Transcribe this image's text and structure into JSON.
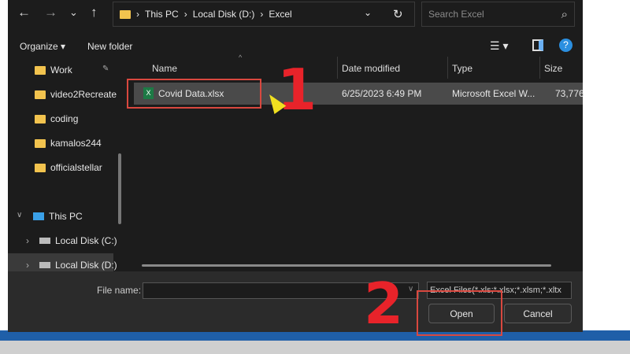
{
  "nav": {
    "back": "←",
    "forward": "→",
    "recent": "⌄",
    "up": "↑"
  },
  "address": {
    "crumbs": [
      "This PC",
      "Local Disk (D:)",
      "Excel"
    ],
    "sep": "›",
    "dropdown": "⌄",
    "refresh": "↻"
  },
  "search": {
    "placeholder": "Search Excel",
    "icon": "⌕"
  },
  "toolbar": {
    "organize": "Organize ▾",
    "new_folder": "New folder",
    "view": "☰ ▾",
    "help": "?"
  },
  "sidebar": {
    "items": [
      {
        "label": "Work",
        "pin": "📌"
      },
      {
        "label": "video2Recreate"
      },
      {
        "label": "coding"
      },
      {
        "label": "kamalos244"
      },
      {
        "label": "officialstellar"
      }
    ],
    "this_pc": "This PC",
    "drives": [
      "Local Disk (C:)",
      "Local Disk (D:)"
    ]
  },
  "columns": [
    "Name",
    "Date modified",
    "Type",
    "Size"
  ],
  "files": [
    {
      "name": "Covid Data.xlsx",
      "date": "6/25/2023 6:49 PM",
      "type": "Microsoft Excel W...",
      "size": "73,776"
    }
  ],
  "footer": {
    "file_name_label": "File name:",
    "file_name_value": "",
    "filter": "Excel Files(*.xls;*.xlsx;*.xlsm;*.xltx",
    "open": "Open",
    "cancel": "Cancel"
  },
  "annotations": {
    "step1": "1",
    "step2": "2"
  }
}
